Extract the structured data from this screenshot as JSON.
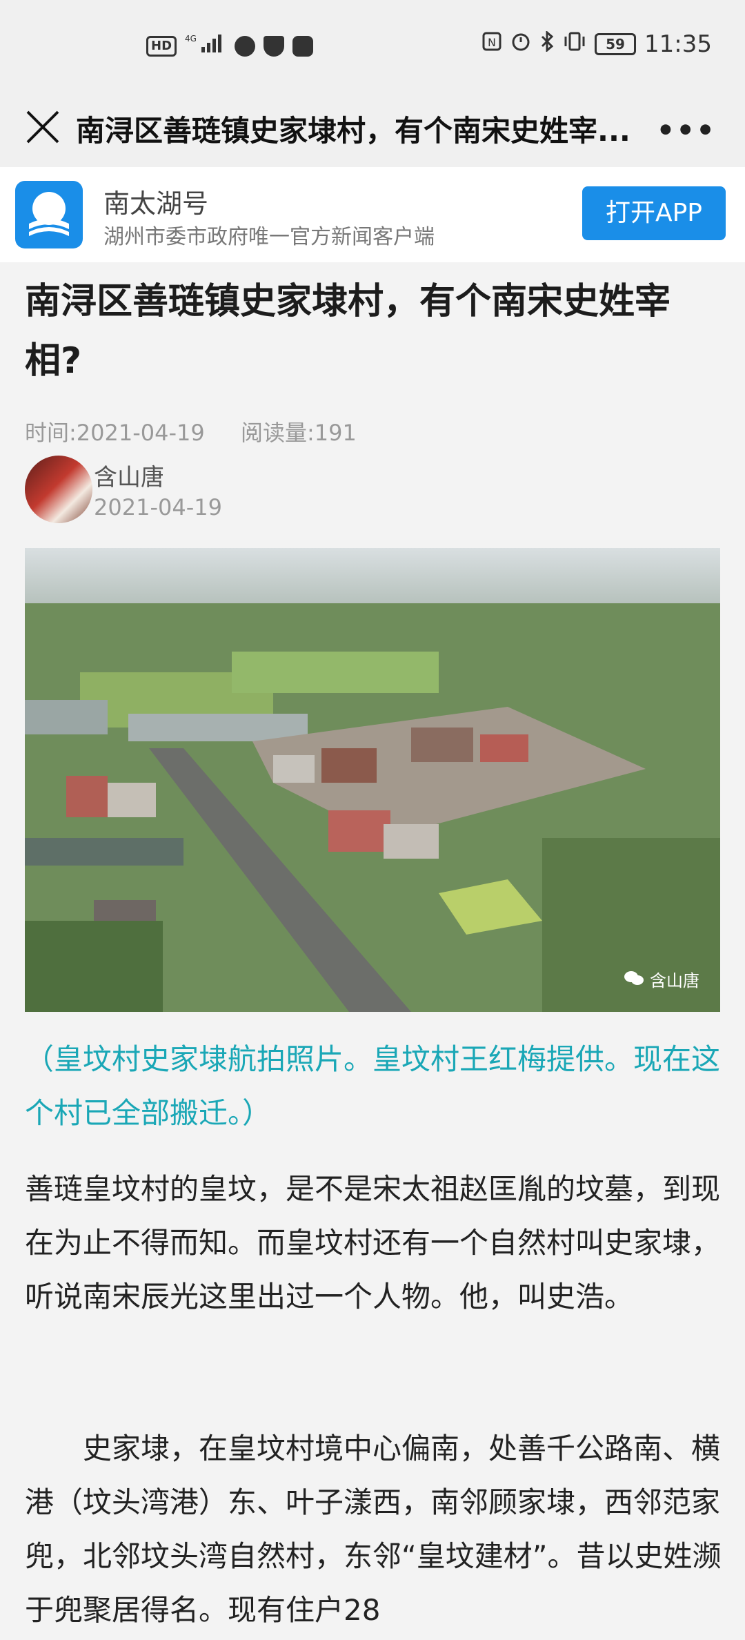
{
  "status_bar": {
    "left_labels": [
      "HD",
      "4G"
    ],
    "time": "11:35",
    "battery": "59"
  },
  "nav": {
    "title": "南浔区善琏镇史家埭村，有个南宋史姓宰...",
    "more": "•••"
  },
  "app_banner": {
    "name": "南太湖号",
    "description": "湖州市委市政府唯一官方新闻客户端",
    "open_button": "打开APP"
  },
  "article": {
    "title": "南浔区善琏镇史家埭村，有个南宋史姓宰相?",
    "time": "时间:2021-04-19",
    "reads": "阅读量:191",
    "author": "含山唐",
    "author_date": "2021-04-19",
    "photo_watermark": "含山唐",
    "caption": "（皇坟村史家埭航拍照片。皇坟村王红梅提供。现在这个村已全部搬迁。）",
    "paragraphs": [
      "善琏皇坟村的皇坟，是不是宋太祖赵匡胤的坟墓，到现在为止不得而知。而皇坟村还有一个自然村叫史家埭，听说南宋辰光这里出过一个人物。他，叫史浩。",
      "　　史家埭，在皇坟村境中心偏南，处善千公路南、横港（坟头湾港）东、叶子漾西，南邻顾家埭，西邻范家兜，北邻坟头湾自然村，东邻“皇坟建材”。昔以史姓濒于兜聚居得名。现有住户28"
    ]
  }
}
